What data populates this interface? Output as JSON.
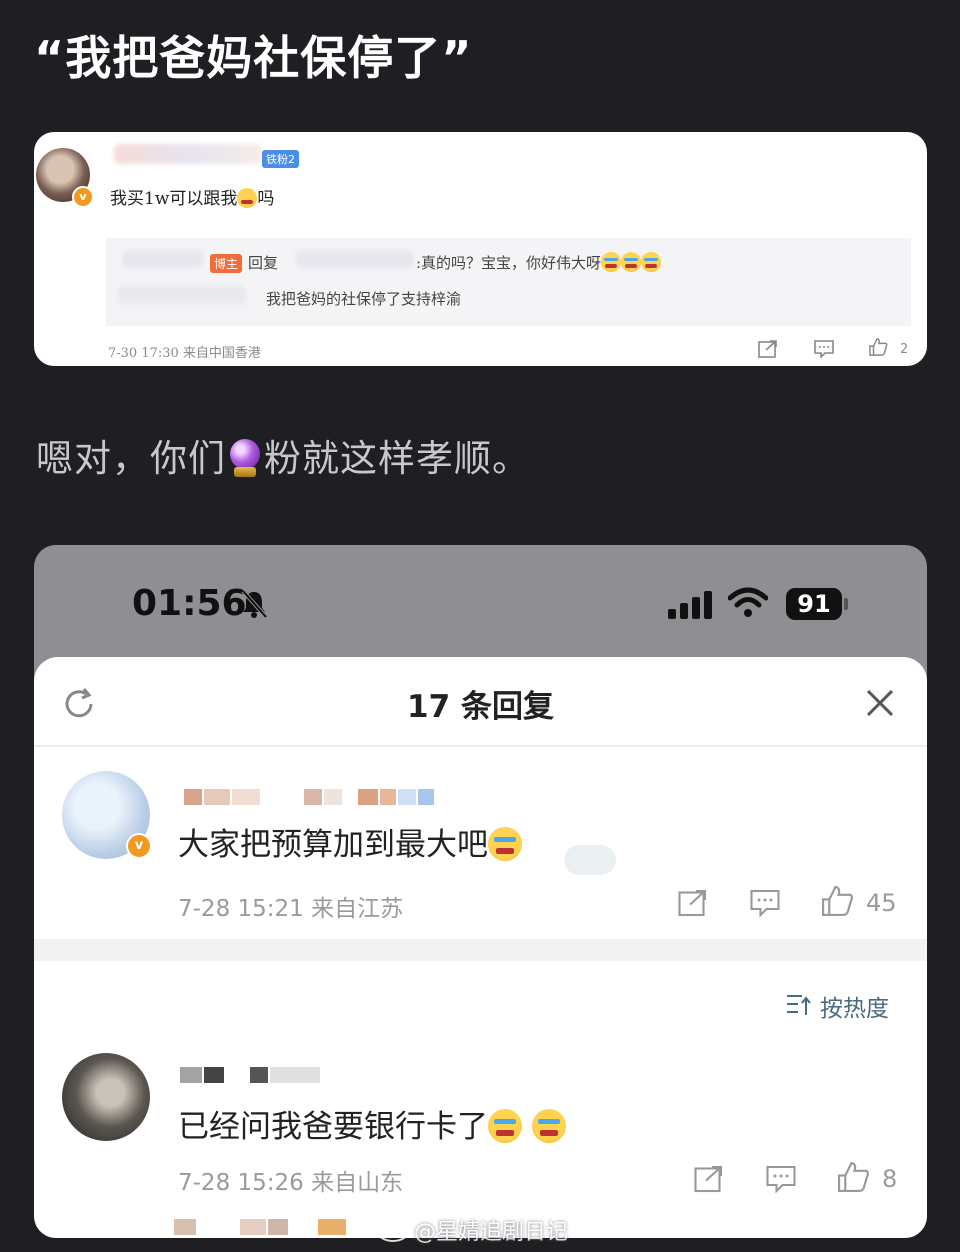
{
  "title": "“我把爸妈社保停了”",
  "card1": {
    "fans_badge": "铁粉2",
    "comment": "我买1w可以跟我",
    "comment_tail": "吗",
    "bozhu_tag": "博主",
    "reply_label": "回复",
    "reply_text": ":真的吗？宝宝，你好伟大呀",
    "reply_line2": "我把爸妈的社保停了支持梓渝",
    "meta": "7-30 17:30 来自中国香港",
    "like_count": "2"
  },
  "middle_text_before": "嗯对，你们",
  "middle_text_after": "粉就这样孝顺。",
  "phone": {
    "time": "01:56",
    "battery": "91",
    "sheet_title": "17 条回复",
    "reply1": {
      "text": "大家把预算加到最大吧",
      "meta": "7-28 15:21 来自江苏",
      "likes": "45"
    },
    "sort_label": "按热度",
    "reply2": {
      "text": "已经问我爸要银行卡了",
      "meta": "7-28 15:26 来自山东",
      "likes": "8"
    }
  },
  "watermark": "@星婧追剧日记",
  "colors": {
    "background": "#1f1f23",
    "vip_badge": "#f39a1e",
    "bozhu": "#f26b3a",
    "fans_badge": "#4a8ee8"
  }
}
